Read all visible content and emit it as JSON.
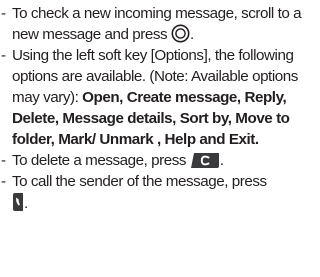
{
  "bullet": "-",
  "items": [
    {
      "text_before": "To check a new incoming message, scroll to a new message and press",
      "text_after": ".",
      "icon": "ok-center-key-icon"
    },
    {
      "text_before": "Using the left soft key [Options], the following options are available. (Note: Available options may vary): ",
      "bold_text": "Open, Create message, Reply, Delete, Message details, Sort by, Move to folder, Mark/ Unmark , Help and Exit."
    },
    {
      "text_before": "To delete a message, press",
      "text_after": ".",
      "icon": "clear-key-icon"
    },
    {
      "text_before": "To call the sender of the message, press",
      "text_after": ".",
      "icon": "send-call-key-icon"
    }
  ],
  "icon_colors": {
    "key_fill": "#3a3a3c",
    "key_symbol": "#ffffff",
    "ring": "#231f20"
  }
}
